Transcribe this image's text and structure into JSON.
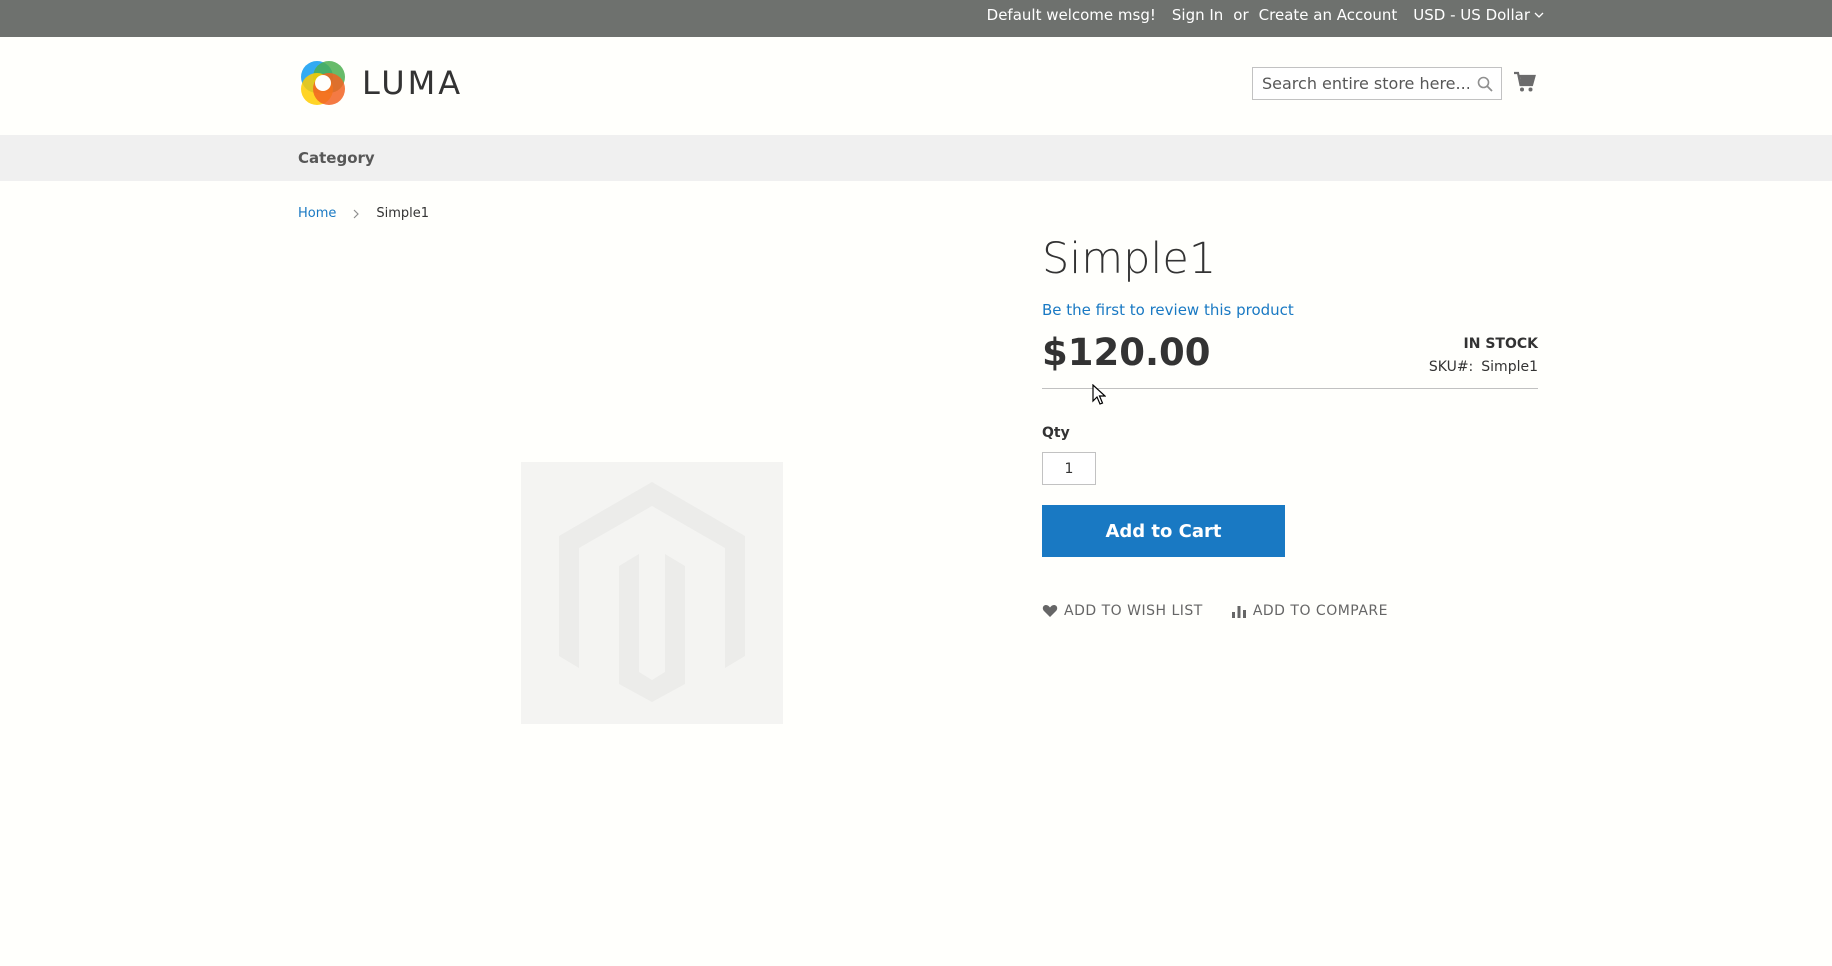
{
  "header": {
    "welcome": "Default welcome msg!",
    "sign_in": "Sign In",
    "or": "or",
    "create_account": "Create an Account",
    "currency": "USD - US Dollar"
  },
  "logo": {
    "text": "LUMA"
  },
  "search": {
    "placeholder": "Search entire store here..."
  },
  "nav": {
    "items": [
      {
        "label": "Category"
      }
    ]
  },
  "breadcrumb": [
    {
      "label": "Home"
    },
    {
      "label": "Simple1"
    }
  ],
  "product": {
    "name": "Simple1",
    "review_link": "Be the first to review this product",
    "price": "$120.00",
    "stock": "IN STOCK",
    "sku_label": "SKU#:",
    "sku_value": "Simple1",
    "qty_label": "Qty",
    "qty_value": "1",
    "add_to_cart": "Add to Cart",
    "add_to_wishlist": "ADD TO WISH LIST",
    "add_to_compare": "ADD TO COMPARE"
  },
  "colors": {
    "header_bg": "#6e716e",
    "nav_bg": "#f0f0f0",
    "accent": "#1979c3",
    "logo_orange": "#f26322",
    "logo_yellow": "#ffcc00",
    "logo_green": "#4caf50",
    "logo_blue": "#1da1f2"
  },
  "icons": {
    "search": "search-icon",
    "cart": "shopping-cart-icon",
    "wishlist": "heart-icon",
    "compare": "bar-chart-icon",
    "breadcrumb_separator": "chevron-right-icon",
    "currency_toggle": "chevron-down-icon"
  }
}
